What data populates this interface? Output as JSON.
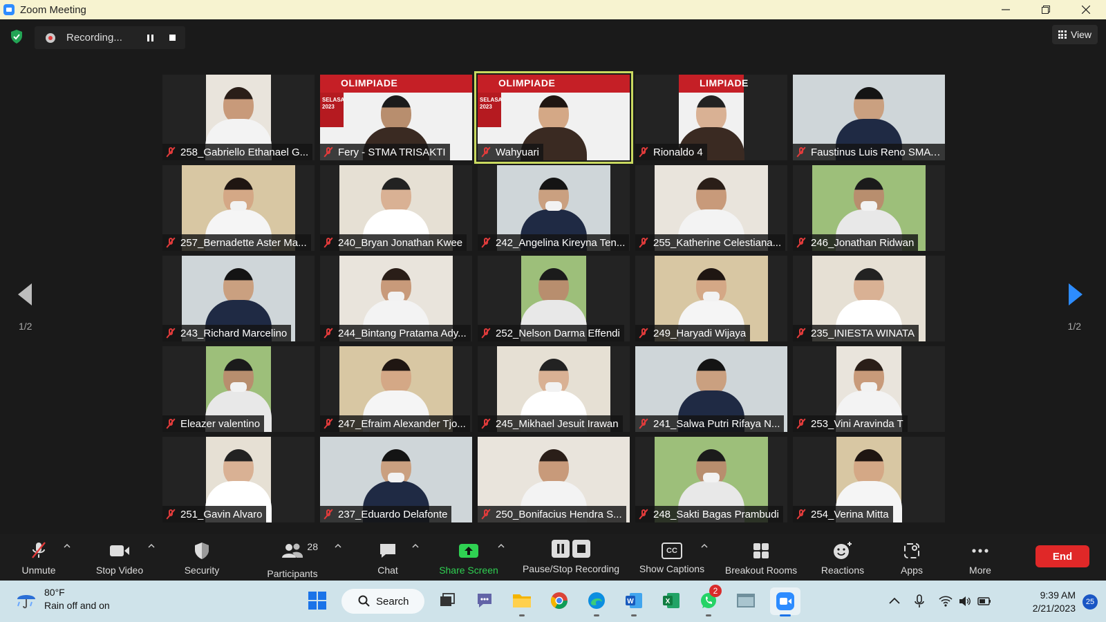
{
  "window": {
    "title": "Zoom Meeting"
  },
  "recording": {
    "status": "Recording..."
  },
  "view_button": {
    "label": "View"
  },
  "pagination": {
    "prev_page": "1/2",
    "next_page": "1/2"
  },
  "participants": [
    {
      "name": "258_Gabriello Ethanael G..."
    },
    {
      "name": "Fery - STMA TRISAKTI",
      "banner": "OLIMPIADE",
      "banner_date": "SELASA 2023"
    },
    {
      "name": "Wahyuari",
      "banner": "OLIMPIADE",
      "banner_date": "SELASA 2023",
      "active": true
    },
    {
      "name": "Rionaldo 4",
      "banner": "LIMPIADE"
    },
    {
      "name": "Faustinus Luis Reno SMA ..."
    },
    {
      "name": "257_Bernadette Aster Ma..."
    },
    {
      "name": "240_Bryan Jonathan Kwee"
    },
    {
      "name": "242_Angelina Kireyna Ten..."
    },
    {
      "name": "255_Katherine Celestiana..."
    },
    {
      "name": "246_Jonathan Ridwan"
    },
    {
      "name": "243_Richard Marcelino"
    },
    {
      "name": "244_Bintang Pratama Ady..."
    },
    {
      "name": "252_Nelson Darma Effendi"
    },
    {
      "name": "249_Haryadi Wijaya"
    },
    {
      "name": "235_INIESTA WINATA"
    },
    {
      "name": "Eleazer valentino"
    },
    {
      "name": "247_Efraim Alexander Tjo..."
    },
    {
      "name": "245_Mikhael Jesuit Irawan"
    },
    {
      "name": "241_Salwa Putri Rifaya N..."
    },
    {
      "name": "253_Vini Aravinda T"
    },
    {
      "name": "251_Gavin Alvaro"
    },
    {
      "name": "237_Eduardo Delafonte"
    },
    {
      "name": "250_Bonifacius Hendra S..."
    },
    {
      "name": "248_Sakti Bagas Prambudi"
    },
    {
      "name": "254_Verina Mitta"
    }
  ],
  "toolbar": {
    "unmute": "Unmute",
    "stop_video": "Stop Video",
    "security": "Security",
    "participants": "Participants",
    "participants_count": "28",
    "chat": "Chat",
    "share_screen": "Share Screen",
    "pause_stop_recording": "Pause/Stop Recording",
    "show_captions": "Show Captions",
    "captions_icon_text": "CC",
    "breakout_rooms": "Breakout Rooms",
    "reactions": "Reactions",
    "apps": "Apps",
    "more": "More",
    "end": "End"
  },
  "taskbar": {
    "weather_temp": "80°F",
    "weather_desc": "Rain off and on",
    "search": "Search",
    "whatsapp_badge": "2",
    "time": "9:39 AM",
    "date": "2/21/2023",
    "notifications": "25"
  },
  "colors": {
    "accent_green": "#2fd152",
    "end_red": "#e02828",
    "active_speaker": "#c9d95f",
    "zoom_blue": "#2d8cff"
  }
}
